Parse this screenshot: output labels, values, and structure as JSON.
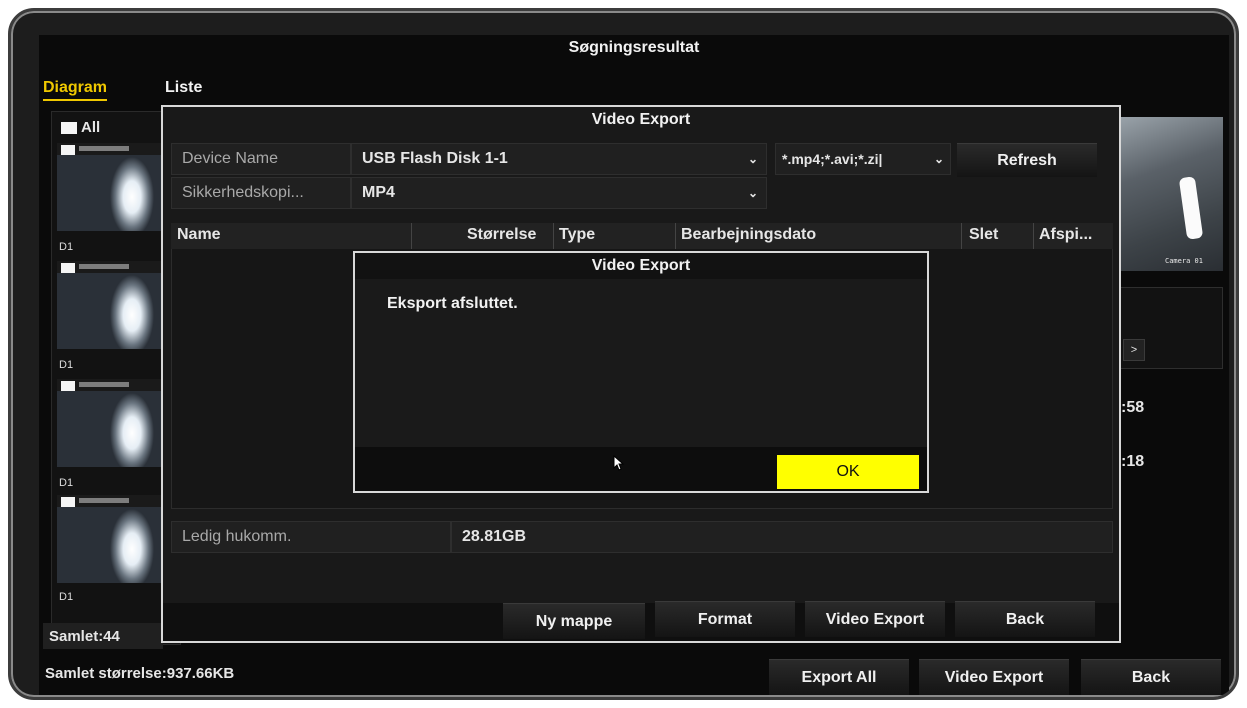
{
  "outer_window": {
    "title": "Søgningsresultat",
    "tabs": [
      "Diagram",
      "Liste"
    ],
    "all_label": "All",
    "thumb_labels": [
      "D1",
      "D1",
      "D1",
      "D1"
    ],
    "total_count": "Samlet:44",
    "total_size": "Samlet størrelse:937.66KB",
    "right_times": [
      ":58",
      ":18"
    ],
    "camera_label": "Camera 01",
    "nav_next": ">",
    "buttons": {
      "export_all": "Export All",
      "video_export": "Video Export",
      "back": "Back"
    }
  },
  "export_dialog": {
    "title": "Video Export",
    "device_name_label": "Device Name",
    "device_name_value": "USB Flash Disk 1-1",
    "file_types": "*.mp4;*.avi;*.zi|",
    "refresh": "Refresh",
    "backup_label": "Sikkerhedskopi...",
    "backup_value": "MP4",
    "columns": [
      "Name",
      "Størrelse",
      "Type",
      "Bearbejningsdato",
      "Slet",
      "Afspi..."
    ],
    "free_label": "Ledig hukomm.",
    "free_value": "28.81GB",
    "buttons": {
      "new_folder": "Ny mappe",
      "format": "Format",
      "video_export": "Video Export",
      "back": "Back"
    }
  },
  "message_dialog": {
    "title": "Video Export",
    "message": "Eksport afsluttet.",
    "ok": "OK"
  },
  "icons": [
    "chevron-down-icon",
    "mouse-cursor-icon",
    "checkbox-icon"
  ],
  "colors": {
    "ok_yellow": "#ffff00",
    "tab_active": "#f0c800"
  }
}
